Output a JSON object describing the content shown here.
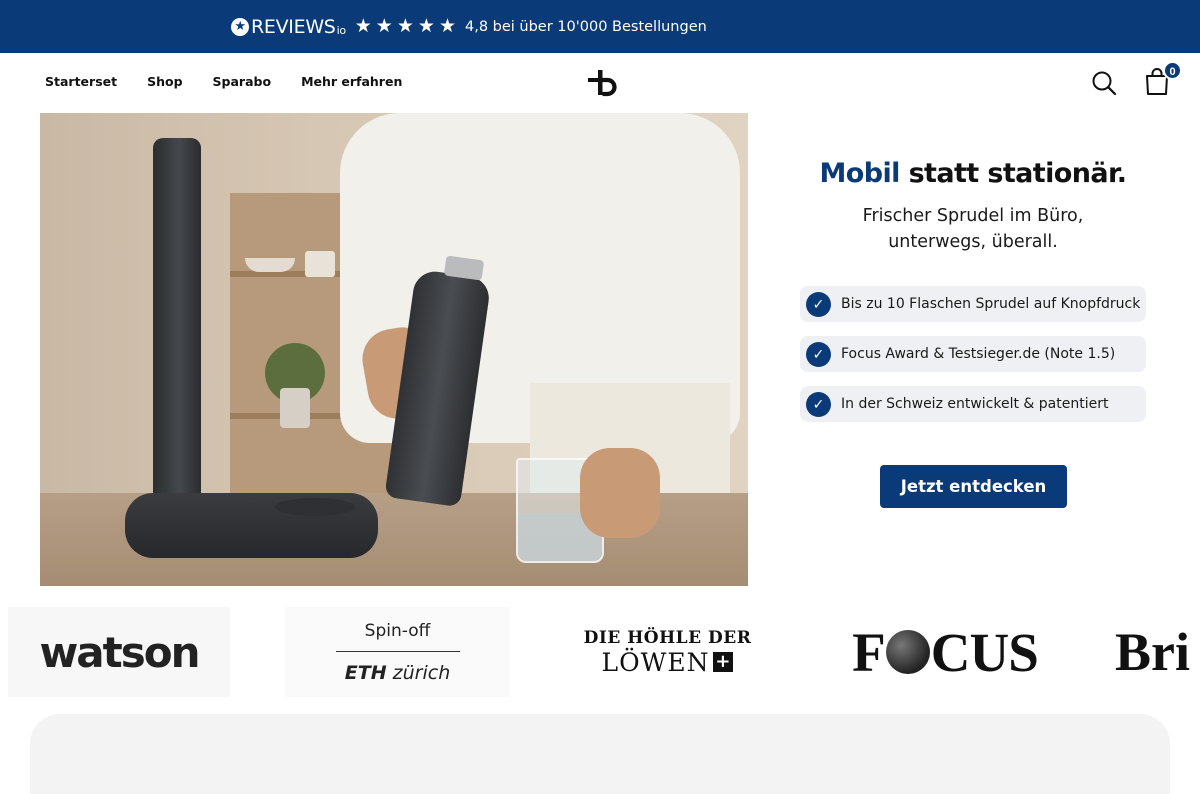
{
  "topbar": {
    "reviews_logo": "REVIEWS",
    "reviews_logo_suffix": "io",
    "stars": [
      "★",
      "★",
      "★",
      "★",
      "★"
    ],
    "rating_text": "4,8 bei über 10'000 Bestellungen",
    "background_color": "#0b3a78"
  },
  "nav": {
    "items": [
      {
        "label": "Starterset"
      },
      {
        "label": "Shop"
      },
      {
        "label": "Sparabo"
      },
      {
        "label": "Mehr erfahren"
      }
    ],
    "logo_icon": "brand-logo-icon",
    "search_icon": "search-icon",
    "cart_icon": "shopping-bag-icon",
    "cart_count": "0"
  },
  "hero": {
    "image_subject": "hero-product-photo"
  },
  "promo": {
    "headline_accent": "Mobil",
    "headline_rest": " statt stationär.",
    "subline_1": "Frischer Sprudel im Büro,",
    "subline_2": "unterwegs, überall.",
    "features": [
      {
        "label": "Bis zu 10 Flaschen Sprudel auf Knopfdruck"
      },
      {
        "label": "Focus Award & Testsieger.de (Note 1.5)"
      },
      {
        "label": "In der Schweiz entwickelt & patentiert"
      }
    ],
    "cta_label": "Jetzt entdecken",
    "accent_color": "#0b3a78"
  },
  "press": {
    "watson": "watson",
    "eth_spin": "Spin-off",
    "eth_bold": "ETH",
    "eth_rest": "zürich",
    "loewen_line1": "DIE HÖHLE DER",
    "loewen_line2": "LÖWEN",
    "focus_f": "F",
    "focus_rest": "CUS",
    "brig": "Bri"
  }
}
